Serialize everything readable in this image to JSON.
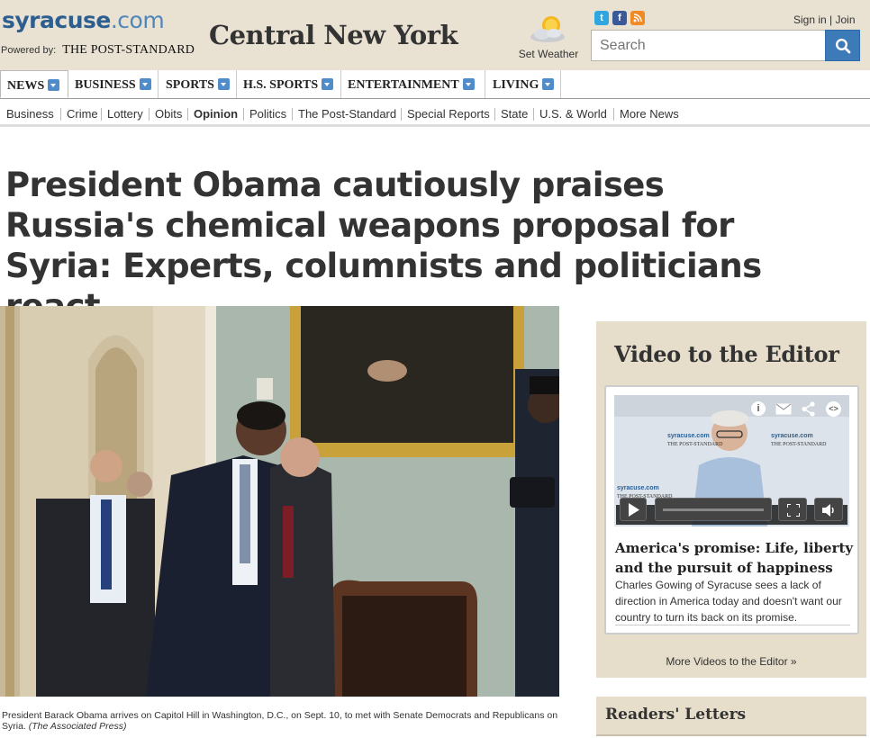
{
  "header": {
    "logo_main": "syracuse",
    "logo_suffix": ".com",
    "powered_by": "Powered by:",
    "partner": "THE POST-STANDARD",
    "region": "Central New York",
    "weather_label": "Set Weather",
    "signin": "Sign in",
    "join": "Join",
    "search_placeholder": "Search",
    "social": [
      "twitter-icon",
      "facebook-icon",
      "rss-icon"
    ]
  },
  "nav": {
    "items": [
      {
        "label": "NEWS"
      },
      {
        "label": "BUSINESS"
      },
      {
        "label": "SPORTS"
      },
      {
        "label": "H.S. SPORTS"
      },
      {
        "label": "ENTERTAINMENT"
      },
      {
        "label": "LIVING"
      }
    ],
    "active": "NEWS"
  },
  "subnav": {
    "items": [
      {
        "label": "Business"
      },
      {
        "label": "Crime"
      },
      {
        "label": "Lottery"
      },
      {
        "label": "Obits"
      },
      {
        "label": "Opinion"
      },
      {
        "label": "Politics"
      },
      {
        "label": "The Post-Standard"
      },
      {
        "label": "Special Reports"
      },
      {
        "label": "State"
      },
      {
        "label": "U.S. & World"
      },
      {
        "label": "More News"
      }
    ],
    "current": "Opinion"
  },
  "article": {
    "headline": "President Obama cautiously praises Russia's chemical weapons proposal for Syria: Experts, columnists and politicians react",
    "caption": "President Barack Obama arrives on Capitol Hill in Washington, D.C., on Sept. 10, to met with Senate Democrats and Republicans on Syria.",
    "credit": "(The Associated Press)"
  },
  "rail": {
    "title": "Video to the Editor",
    "video_title": "America's promise: Life, liberty and the pursuit of happiness",
    "video_description": "Charles Gowing of Syracuse sees a lack of direction in America today and doesn't want our country to turn its back on its promise.",
    "more_link": "More Videos to the Editor »",
    "video_logo_text": "syracuse.com",
    "video_partner_text": "THE POST-STANDARD"
  },
  "rail2": {
    "title": "Readers' Letters"
  },
  "colors": {
    "header_bg": "#e9e2d3",
    "brand_blue": "#2d5e90",
    "search_button": "#3d7ab8",
    "rail_bg": "#e6ddcb"
  }
}
